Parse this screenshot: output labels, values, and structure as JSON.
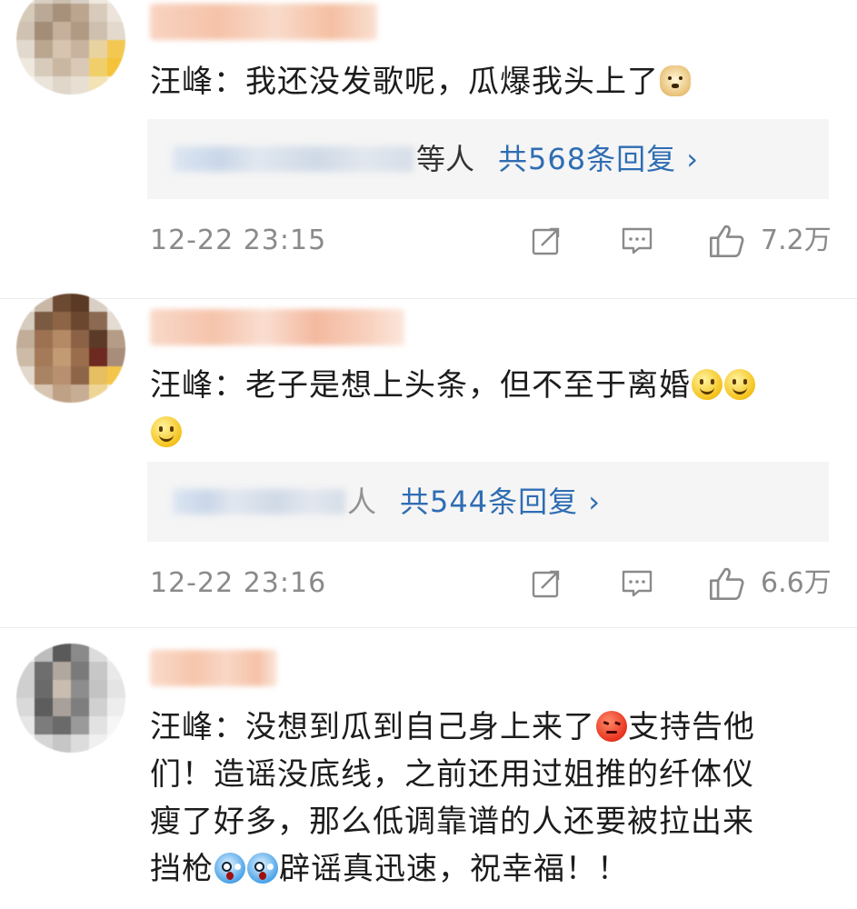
{
  "comments": [
    {
      "text_parts": [
        "汪峰：我还没发歌呢，瓜爆我头上了"
      ],
      "reply_suffix": "等人",
      "reply_link": "共568条回复 ›",
      "time": "12-22 23:15",
      "likes": "7.2万"
    },
    {
      "text_line1": "汪峰：老子是想上头条，但不至于离婚",
      "reply_suffix": "人",
      "reply_link": "共544条回复 ›",
      "time": "12-22 23:16",
      "likes": "6.6万"
    },
    {
      "part_a": "汪峰：没想到瓜到自己身上来了",
      "part_b": "支持告他",
      "line2": "们！造谣没底线，之前还用过姐推的纤体仪",
      "line3": "瘦了好多，那么低调靠谱的人还要被拉出来",
      "line4a": "挡枪",
      "line4b": "辟谣真迅速，祝幸福！！"
    }
  ],
  "icons": {
    "repost": "repost-icon",
    "comment": "comment-icon",
    "like": "thumbs-up-icon",
    "emoji_doge": "doge-emoji-icon",
    "emoji_smile": "smile-emoji-icon",
    "emoji_angry": "angry-emoji-icon",
    "emoji_scream": "scream-emoji-icon"
  },
  "colors": {
    "link": "#2f6db3",
    "meta": "#8a8a8a",
    "reply_bg": "#f5f5f5"
  }
}
